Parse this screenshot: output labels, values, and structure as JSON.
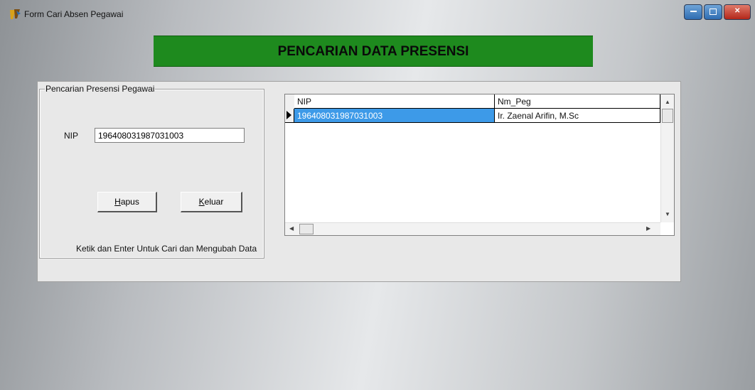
{
  "window": {
    "title": "Form Cari Absen Pegawai",
    "icon": "delphi-app-icon",
    "controls": {
      "minimize": "minimize-icon",
      "maximize": "maximize-icon",
      "close": "close-icon"
    }
  },
  "banner": {
    "text": "PENCARIAN DATA PRESENSI",
    "color": "#1e8a1e"
  },
  "group": {
    "legend": "Pencarian Presensi Pegawai"
  },
  "form": {
    "nip_label": "NIP",
    "nip_value": "196408031987031003"
  },
  "buttons": {
    "hapus": {
      "mnemonic": "H",
      "rest": "apus"
    },
    "keluar": {
      "mnemonic": "K",
      "rest": "eluar"
    }
  },
  "hint": "Ketik dan Enter Untuk Cari dan Mengubah Data",
  "grid": {
    "columns": [
      "NIP",
      "Nm_Peg"
    ],
    "rows": [
      {
        "nip": "196408031987031003",
        "nm_peg": "Ir. Zaenal Arifin, M.Sc"
      }
    ],
    "selected_color": "#3d9ae8"
  }
}
